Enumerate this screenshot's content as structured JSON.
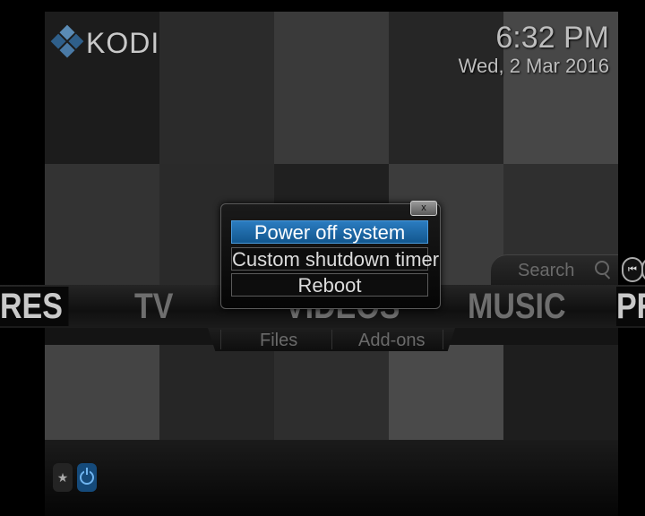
{
  "app": {
    "logo_text": "KODI"
  },
  "clock": {
    "time": "6:32 PM",
    "date": "Wed, 2 Mar 2016"
  },
  "search": {
    "label": "Search"
  },
  "main_menu": {
    "items": [
      {
        "label": "RES"
      },
      {
        "label": "TV"
      },
      {
        "label": "VIDEOS"
      },
      {
        "label": "MUSIC"
      },
      {
        "label": "PR"
      }
    ]
  },
  "submenu": {
    "items": [
      {
        "label": "Files"
      },
      {
        "label": "Add-ons"
      }
    ]
  },
  "dialog": {
    "close_label": "x",
    "options": [
      {
        "label": "Power off system",
        "focused": true
      },
      {
        "label": "Custom shutdown timer",
        "focused": false
      },
      {
        "label": "Reboot",
        "focused": false
      }
    ]
  },
  "colors": {
    "accent": "#1a6aad",
    "background": "#141414"
  },
  "icons": [
    "kodi-logo-icon",
    "search-icon",
    "skip-previous-icon",
    "favourites-icon",
    "power-icon"
  ]
}
